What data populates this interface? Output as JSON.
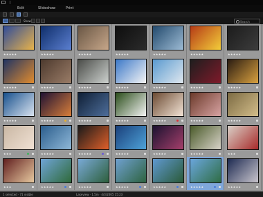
{
  "menu": {
    "tabs": [
      "Edit",
      "Slideshow",
      "Print"
    ]
  },
  "search": {
    "placeholder": "Search"
  },
  "filter": {
    "label": "Show"
  },
  "status": {
    "left": "1 selected · 71 visible",
    "center": "Lakeview · 1.5m · 4/3/2005 15:23"
  },
  "rows": [
    {
      "cells": [
        {
          "colors": [
            "#2f4c9a",
            "#e8b34a"
          ],
          "stars": "★★★★★"
        },
        {
          "colors": [
            "#0f2e6a",
            "#5b7fd0"
          ],
          "stars": "★★★★★"
        },
        {
          "colors": [
            "#6a5745",
            "#c7a78a"
          ],
          "stars": "★★★★★"
        },
        {
          "colors": [
            "#0e0e0e",
            "#2b2b2b"
          ],
          "stars": "★★★★★"
        },
        {
          "colors": [
            "#234a6d",
            "#9dbbd4"
          ],
          "stars": "★★★★★"
        },
        {
          "colors": [
            "#b53b16",
            "#f3cd3a"
          ],
          "stars": "★★★★★"
        },
        {
          "colors": [
            "#1c1c1c",
            "#3c3c3c"
          ],
          "stars": "★★★★★"
        }
      ]
    },
    {
      "cells": [
        {
          "colors": [
            "#1f3464",
            "#e08b2e"
          ],
          "stars": "★★★★★",
          "badge": true
        },
        {
          "colors": [
            "#4d3a2e",
            "#9a7c67"
          ],
          "stars": "★★★★★",
          "badge": true
        },
        {
          "colors": [
            "#4b4d49",
            "#cdd1ce"
          ],
          "stars": "★★★★★",
          "badge": true
        },
        {
          "colors": [
            "#3b78c8",
            "#f4f4f4"
          ],
          "stars": "★★★★★",
          "badge": true
        },
        {
          "colors": [
            "#5a9ad0",
            "#dfe7ee"
          ],
          "stars": "★★★★★",
          "badge": true
        },
        {
          "colors": [
            "#1e1e1e",
            "#7e1a2a"
          ],
          "stars": "★★★★★",
          "badge": true
        },
        {
          "colors": [
            "#2a1c12",
            "#d9a13f"
          ],
          "stars": "★★★★★",
          "badge": true
        }
      ]
    },
    {
      "cells": [
        {
          "colors": [
            "#17508d",
            "#d9e3ef"
          ],
          "stars": "★★★★★",
          "badge": true
        },
        {
          "colors": [
            "#1f1233",
            "#d97f3b"
          ],
          "stars": "★★★★★",
          "badge": true,
          "flag": "#e8b02a"
        },
        {
          "colors": [
            "#0f1f35",
            "#4e6e9b"
          ],
          "stars": "★★★★★",
          "badge": true
        },
        {
          "colors": [
            "#2a4d1a",
            "#f3f3f3"
          ],
          "stars": "★★★★★",
          "badge": true
        },
        {
          "colors": [
            "#6c4b33",
            "#f3e4d6"
          ],
          "stars": "★★★★★",
          "badge": true,
          "flag": "#d9353a"
        },
        {
          "colors": [
            "#6b3a2a",
            "#d8a3a3"
          ],
          "stars": "★★★★★",
          "badge": true
        },
        {
          "colors": [
            "#7c6b43",
            "#d3bd8a"
          ],
          "stars": "★★★★★",
          "badge": true
        }
      ]
    },
    {
      "cells": [
        {
          "colors": [
            "#c9b7a3",
            "#f0e1d4"
          ],
          "stars": "★★★",
          "badge": true,
          "flag": "#3fb35d"
        },
        {
          "colors": [
            "#2b5d8c",
            "#8fb8d8"
          ],
          "stars": "★★★★★",
          "badge": true
        },
        {
          "colors": [
            "#1a1a1a",
            "#e0602a"
          ],
          "stars": "★★★★★",
          "badge": true,
          "flag": "#6a5ad8"
        },
        {
          "colors": [
            "#1a3f7a",
            "#4ea3d9"
          ],
          "stars": "★★★★★",
          "badge": true
        },
        {
          "colors": [
            "#1b1230",
            "#a63f6b"
          ],
          "stars": "★★★★★",
          "badge": true
        },
        {
          "colors": [
            "#4a5a2a",
            "#d8d3c8"
          ],
          "stars": "★★★★★",
          "badge": true
        },
        {
          "colors": [
            "#d9d0c7",
            "#a82a2a"
          ],
          "stars": "★★★",
          "badge": true
        }
      ]
    },
    {
      "cells": [
        {
          "colors": [
            "#611f1f",
            "#e7c9a0"
          ],
          "stars": "★★★",
          "badge": true
        },
        {
          "colors": [
            "#6fa4d6",
            "#2f6a3a"
          ],
          "stars": "★★★★★",
          "badge": true,
          "flag": "#4a7cd8"
        },
        {
          "colors": [
            "#79a9d6",
            "#2d5f3c"
          ],
          "stars": "★★★★★",
          "badge": true
        },
        {
          "colors": [
            "#6fa0d0",
            "#2e6340"
          ],
          "stars": "★★★★★",
          "badge": true,
          "flag": "#4a7cd8"
        },
        {
          "colors": [
            "#5f98cf",
            "#2a5a38"
          ],
          "stars": "★★★★★",
          "badge": true,
          "flag": "#4a7cd8"
        },
        {
          "colors": [
            "#6aa6dc",
            "#2f6d45"
          ],
          "stars": "★★★★★",
          "badge": true,
          "flag": "#4a7cd8"
        },
        {
          "colors": [
            "#1e2b52",
            "#c9c5cd"
          ],
          "stars": "★★★★★",
          "badge": true
        }
      ]
    }
  ]
}
